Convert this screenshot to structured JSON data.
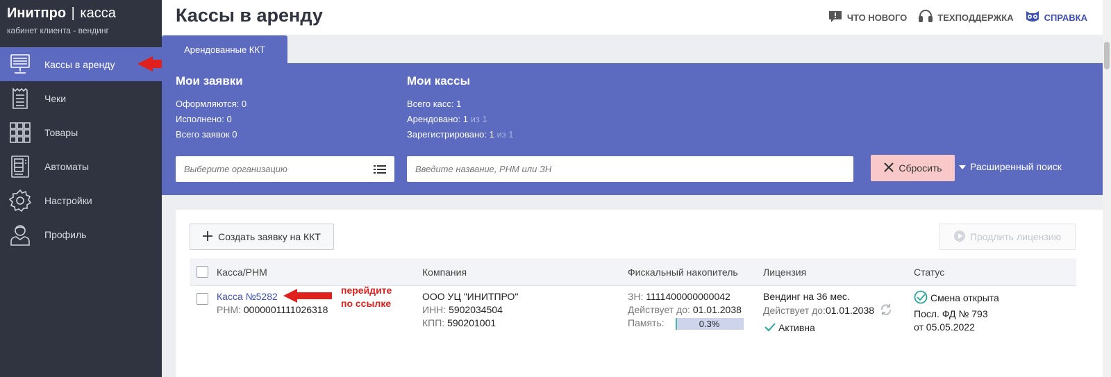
{
  "brand": {
    "name": "Инитпро",
    "separator": "|",
    "product": "касса",
    "subtitle": "кабинет клиента - вендинг"
  },
  "sidebar": {
    "items": [
      {
        "label": "Кассы в аренду",
        "icon": "cash-register-icon",
        "active": true
      },
      {
        "label": "Чеки",
        "icon": "receipt-icon"
      },
      {
        "label": "Товары",
        "icon": "grid-icon"
      },
      {
        "label": "Автоматы",
        "icon": "vending-machine-icon"
      },
      {
        "label": "Настройки",
        "icon": "gear-icon"
      },
      {
        "label": "Профиль",
        "icon": "user-icon"
      }
    ]
  },
  "header": {
    "title": "Кассы в аренду",
    "links": [
      {
        "label": "ЧТО НОВОГО",
        "icon": "megaphone-icon"
      },
      {
        "label": "ТЕХПОДДЕРЖКА",
        "icon": "headset-icon"
      },
      {
        "label": "СПРАВКА",
        "icon": "owl-icon"
      }
    ]
  },
  "tab": {
    "label": "Арендованные ККТ"
  },
  "summary": {
    "requests": {
      "title": "Мои заявки",
      "in_progress": "Оформляются: 0",
      "done": "Исполнено: 0",
      "total": "Всего заявок 0"
    },
    "kassas": {
      "title": "Мои кассы",
      "total": "Всего касс: 1",
      "rented": "Арендовано: 1",
      "rented_of": "из 1",
      "registered": "Зарегистрировано: 1",
      "registered_of": "из 1"
    }
  },
  "filters": {
    "org_placeholder": "Выберите организацию",
    "search_placeholder": "Введите название, РНМ или ЗН",
    "reset_label": "Сбросить",
    "advanced_label": "Расширенный поиск"
  },
  "actions": {
    "create_label": "Создать заявку на ККТ",
    "extend_label": "Продлить лицензию"
  },
  "table": {
    "headers": [
      "Касса/РНМ",
      "Компания",
      "Фискальный накопитель",
      "Лицензия",
      "Статус"
    ],
    "row": {
      "kassa_name": "Касса №5282",
      "rnm_label": "РНМ:",
      "rnm": "0000001111026318",
      "company": "ООО УЦ \"ИНИТПРО\"",
      "inn_label": "ИНН:",
      "inn": "5902034504",
      "kpp_label": "КПП:",
      "kpp": "590201001",
      "zn_label": "ЗН:",
      "zn": "1111400000000042",
      "fn_valid_label": "Действует до:",
      "fn_valid": "01.01.2038",
      "memory_label": "Память:",
      "memory_text": "0.3%",
      "memory_fraction": 0.03,
      "license": "Вендинг на 36 мес.",
      "license_valid_label": "Действует до:",
      "license_valid": "01.01.2038",
      "license_state": "Активна",
      "status": "Смена открыта",
      "last_fd": "Посл. ФД № 793",
      "last_fd_date": "от 05.05.2022"
    }
  },
  "annotation": {
    "line1": "перейдите",
    "line2": "по ссылке"
  },
  "colors": {
    "sidebar": "#2f3440",
    "accent": "#5c6bc0",
    "reset": "#f9c9c9",
    "annotation": "#e0201c"
  }
}
